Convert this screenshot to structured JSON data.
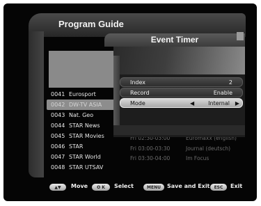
{
  "app": {
    "title": "Program Guide"
  },
  "dialog": {
    "title": "Event Timer",
    "fields": [
      {
        "label": "Index",
        "value": "2"
      },
      {
        "label": "Record",
        "value": "Enable"
      },
      {
        "label": "Mode",
        "value": "Internal"
      }
    ]
  },
  "channels": [
    {
      "num": "0041",
      "name": "Eurosport"
    },
    {
      "num": "0042",
      "name": "DW-TV ASIA"
    },
    {
      "num": "0043",
      "name": "Nat. Geo"
    },
    {
      "num": "0044",
      "name": "STAR News"
    },
    {
      "num": "0045",
      "name": "STAR Movies"
    },
    {
      "num": "0046",
      "name": "STAR"
    },
    {
      "num": "0047",
      "name": "STAR World"
    },
    {
      "num": "0048",
      "name": "STAR UTSAV"
    }
  ],
  "programs": [
    {
      "time": "Fri 02:30-03:00",
      "title": "Euromaxx (english)"
    },
    {
      "time": "Fri 03:00-03:30",
      "title": "Journal (deutsch)"
    },
    {
      "time": "Fri 03:30-04:00",
      "title": "Im Focus"
    }
  ],
  "help": {
    "move": "Move",
    "ok_key": "O K",
    "select": "Select",
    "menu_key": "MENU",
    "save_exit": "Save and Exit",
    "esc_key": "ESC",
    "exit": "Exit"
  }
}
